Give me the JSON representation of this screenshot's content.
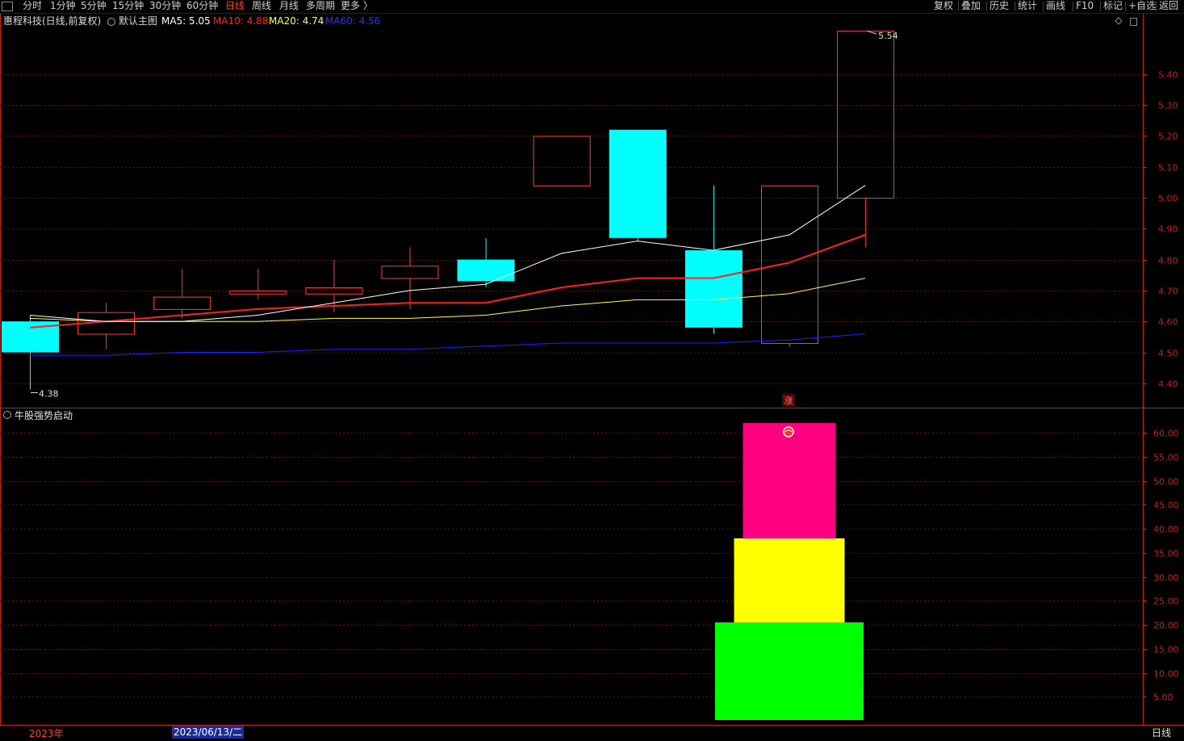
{
  "toolbar": {
    "left": [
      {
        "label": "分时",
        "active": false
      },
      {
        "label": "1分钟",
        "active": false
      },
      {
        "label": "5分钟",
        "active": false
      },
      {
        "label": "15分钟",
        "active": false
      },
      {
        "label": "30分钟",
        "active": false
      },
      {
        "label": "60分钟",
        "active": false
      },
      {
        "label": "日线",
        "active": true
      },
      {
        "label": "周线",
        "active": false
      },
      {
        "label": "月线",
        "active": false
      },
      {
        "label": "多周期",
        "active": false
      },
      {
        "label": "更多 〉",
        "active": false
      }
    ],
    "right": [
      "复权",
      "叠加",
      "历史",
      "统计",
      "画线",
      "F10",
      "标记",
      "+自选",
      "返回"
    ]
  },
  "header": {
    "stock": "惠程科技(日线,前复权)",
    "chart_name": "默认主图",
    "ma5": "MA5: 5.05",
    "ma10": "MA10: 4.88",
    "ma20": "MA20: 4.74",
    "ma60": "MA60: 4.56"
  },
  "colors": {
    "up": "#ff3a3a",
    "down": "#00ffff",
    "ma5": "#ffffff",
    "ma10": "#ff2020",
    "ma20": "#ffff40",
    "ma60": "#2020ff",
    "axis": "#c81e1e",
    "grid": "#5a1414"
  },
  "indicator": {
    "title": "牛股强势启动"
  },
  "footer": {
    "year": "2023年",
    "date": "2023/06/13/二",
    "period": "日线"
  },
  "chart_data": [
    {
      "type": "candlestick",
      "ylim": [
        4.35,
        5.57
      ],
      "yticks": [
        "5.40",
        "5.30",
        "5.20",
        "5.10",
        "5.00",
        "4.90",
        "4.80",
        "4.70",
        "4.60",
        "4.50",
        "4.40"
      ],
      "candles": [
        {
          "open": 4.6,
          "close": 4.5,
          "high": 4.62,
          "low": 4.38
        },
        {
          "open": 4.56,
          "close": 4.63,
          "high": 4.66,
          "low": 4.51
        },
        {
          "open": 4.64,
          "close": 4.68,
          "high": 4.77,
          "low": 4.61
        },
        {
          "open": 4.69,
          "close": 4.7,
          "high": 4.77,
          "low": 4.67
        },
        {
          "open": 4.69,
          "close": 4.71,
          "high": 4.8,
          "low": 4.63
        },
        {
          "open": 4.74,
          "close": 4.78,
          "high": 4.84,
          "low": 4.64
        },
        {
          "open": 4.8,
          "close": 4.73,
          "high": 4.87,
          "low": 4.71
        },
        {
          "open": 5.04,
          "close": 5.2,
          "high": 5.2,
          "low": 5.04
        },
        {
          "open": 5.22,
          "close": 4.87,
          "high": 5.22,
          "low": 4.86
        },
        {
          "open": 4.83,
          "close": 4.58,
          "high": 5.04,
          "low": 4.56
        },
        {
          "open": 4.53,
          "close": 5.04,
          "high": 5.04,
          "low": 4.52
        },
        {
          "open": 5.0,
          "close": 5.54,
          "high": 5.54,
          "low": 4.84
        }
      ],
      "ma5": [
        4.62,
        4.6,
        4.6,
        4.62,
        4.66,
        4.7,
        4.72,
        4.82,
        4.86,
        4.83,
        4.88,
        5.04
      ],
      "ma10": [
        4.58,
        4.6,
        4.62,
        4.64,
        4.65,
        4.66,
        4.66,
        4.71,
        4.74,
        4.74,
        4.79,
        4.88
      ],
      "ma20": [
        4.61,
        4.6,
        4.6,
        4.6,
        4.61,
        4.61,
        4.62,
        4.65,
        4.67,
        4.67,
        4.69,
        4.74
      ],
      "ma60": [
        4.49,
        4.49,
        4.5,
        4.5,
        4.51,
        4.51,
        4.52,
        4.53,
        4.53,
        4.53,
        4.54,
        4.56
      ],
      "annotations": {
        "high": "5.54",
        "low": "4.38",
        "signal": "涨"
      }
    },
    {
      "type": "bar",
      "title": "牛股强势启动",
      "ylim": [
        0,
        64
      ],
      "yticks": [
        "60.00",
        "55.00",
        "50.00",
        "45.00",
        "40.00",
        "35.00",
        "30.00",
        "25.00",
        "20.00",
        "15.00",
        "10.00",
        "5.00"
      ],
      "blocks": [
        {
          "from": -4,
          "to": 20.5,
          "color": "#00ff00",
          "width": "wide"
        },
        {
          "from": 20.5,
          "to": 38,
          "color": "#ffff00",
          "width": "medium"
        },
        {
          "from": 38,
          "to": 62,
          "color": "#ff0080",
          "width": "narrow"
        }
      ]
    }
  ]
}
